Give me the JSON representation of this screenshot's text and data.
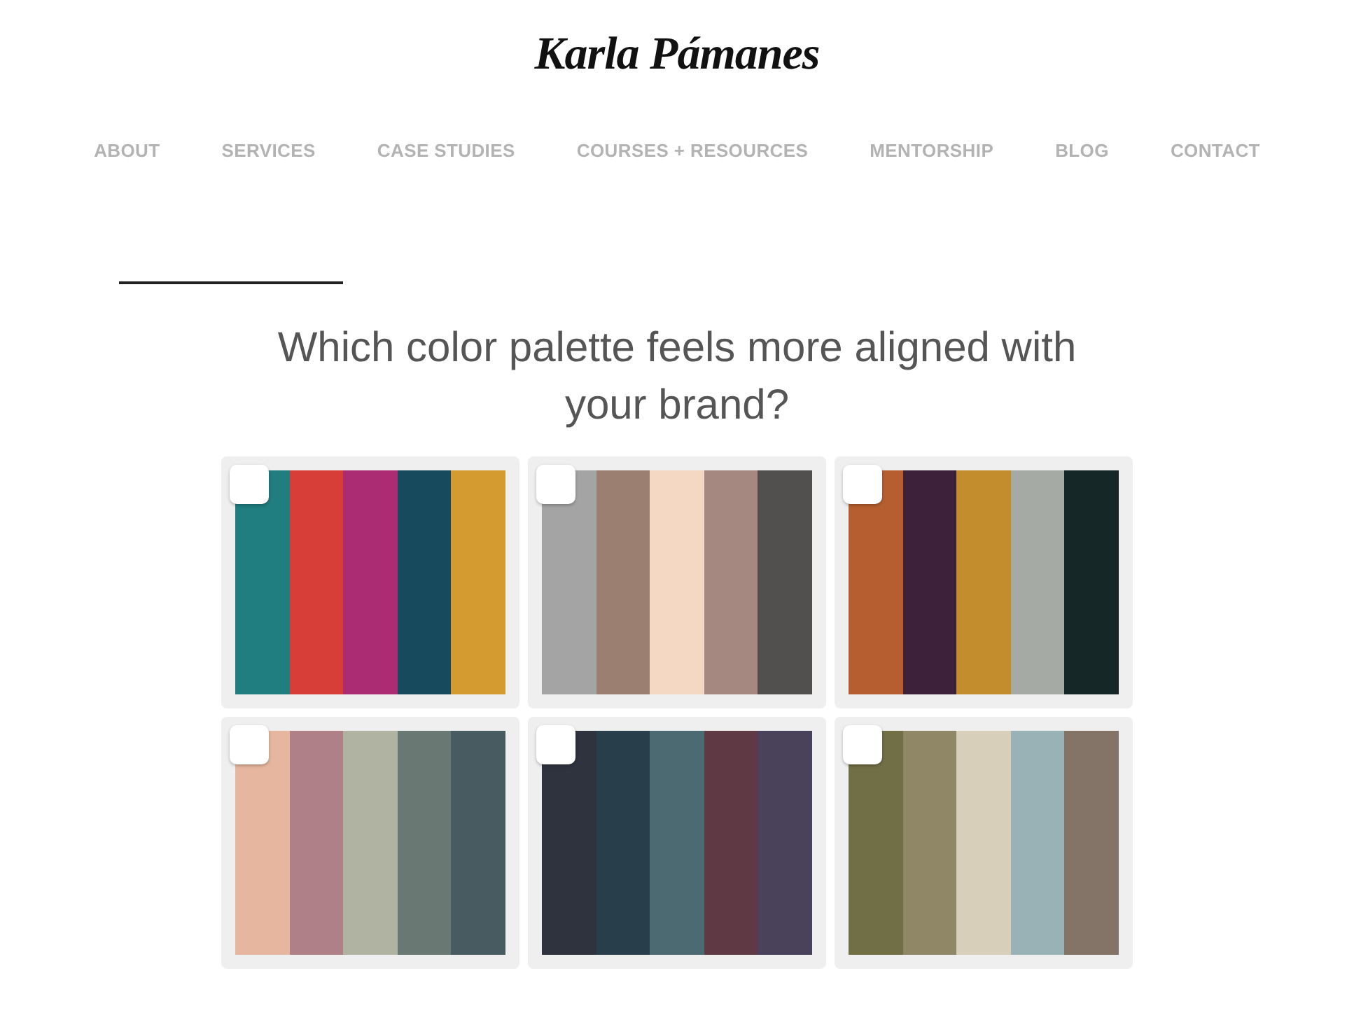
{
  "logo": {
    "text": "Karla Pámanes"
  },
  "nav": [
    {
      "label": "ABOUT"
    },
    {
      "label": "SERVICES"
    },
    {
      "label": "CASE STUDIES"
    },
    {
      "label": "COURSES + RESOURCES"
    },
    {
      "label": "MENTORSHIP"
    },
    {
      "label": "BLOG"
    },
    {
      "label": "CONTACT"
    }
  ],
  "question": "Which color palette feels more aligned with your brand?",
  "palettes": [
    {
      "checked": false,
      "swatches": [
        {
          "color": "#207d80"
        },
        {
          "color": "#d83e38"
        },
        {
          "color": "#ab2c73"
        },
        {
          "color": "#184a5e"
        },
        {
          "color": "#d39b30"
        }
      ]
    },
    {
      "checked": false,
      "swatches": [
        {
          "color": "#a4a4a4"
        },
        {
          "color": "#9b7f71"
        },
        {
          "color": "#f4d8c3"
        },
        {
          "color": "#a5887f"
        },
        {
          "color": "#52504e"
        }
      ]
    },
    {
      "checked": false,
      "swatches": [
        {
          "color": "#b65e2f"
        },
        {
          "color": "#3d2039"
        },
        {
          "color": "#c38d2d"
        },
        {
          "color": "#a6aaa4"
        },
        {
          "color": "#152727"
        }
      ]
    },
    {
      "checked": false,
      "swatches": [
        {
          "color": "#e6b79e"
        },
        {
          "color": "#b08089"
        },
        {
          "color": "#b0b2a2"
        },
        {
          "color": "#697873"
        },
        {
          "color": "#485b61"
        }
      ]
    },
    {
      "checked": false,
      "swatches": [
        {
          "color": "#2e333e"
        },
        {
          "color": "#283f4b"
        },
        {
          "color": "#4c6a72"
        },
        {
          "color": "#5f3944"
        },
        {
          "color": "#49425a"
        }
      ]
    },
    {
      "checked": false,
      "swatches": [
        {
          "color": "#706f46"
        },
        {
          "color": "#908767"
        },
        {
          "color": "#d8cfbb"
        },
        {
          "color": "#98b2b6"
        },
        {
          "color": "#837467"
        }
      ]
    }
  ]
}
